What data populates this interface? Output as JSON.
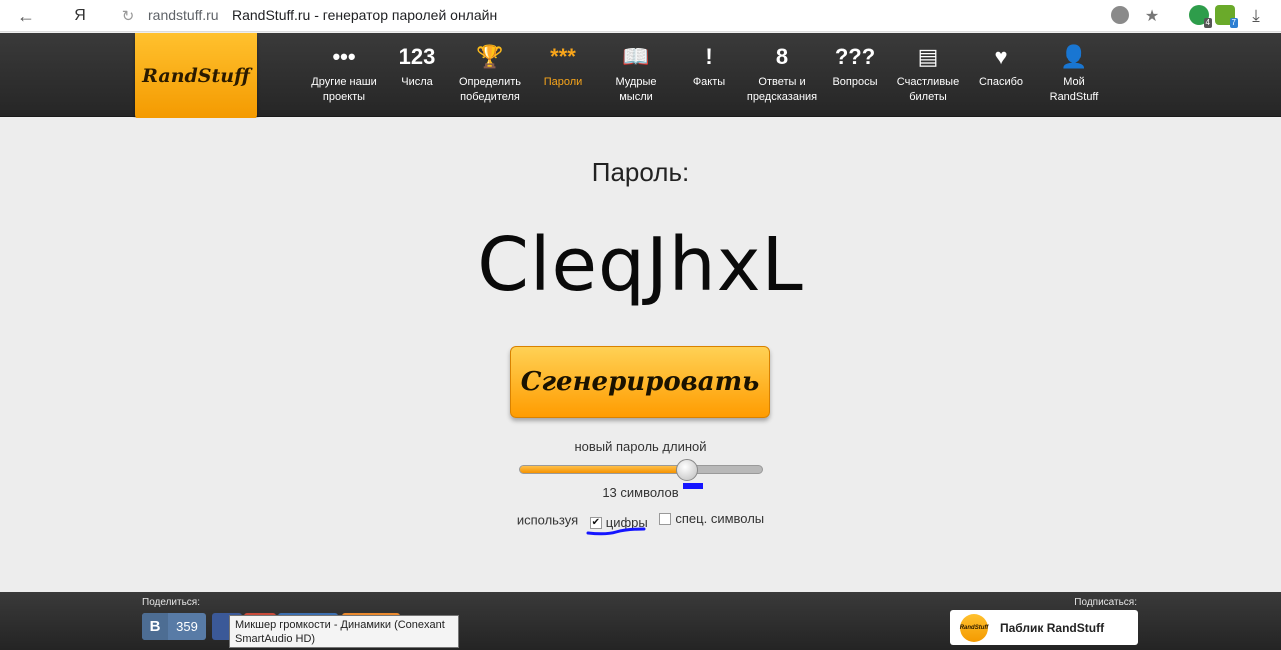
{
  "browser": {
    "back_icon": "back-arrow-icon",
    "yandex_icon": "yandex-logo-icon",
    "reload_icon": "reload-icon",
    "domain": "randstuff.ru",
    "title": "RandStuff.ru - генератор паролей онлайн",
    "extension_badges": [
      "4",
      "7"
    ]
  },
  "site": {
    "logo_text": "RandStuff",
    "nav": [
      {
        "icon": "dots-icon",
        "glyph": "•••",
        "label": "Другие наши\nпроекты"
      },
      {
        "icon": "numbers-icon",
        "glyph": "123",
        "label": "Числа"
      },
      {
        "icon": "trophy-icon",
        "glyph": "🏆",
        "label": "Определить\nпобедителя"
      },
      {
        "icon": "password-stars-icon",
        "glyph": "***",
        "label": "Пароли",
        "active": true
      },
      {
        "icon": "book-icon",
        "glyph": "📖",
        "label": "Мудрые\nмысли"
      },
      {
        "icon": "warning-diamond-icon",
        "glyph": "!",
        "label": "Факты"
      },
      {
        "icon": "magic-ball-icon",
        "glyph": "8",
        "label": "Ответы и\nпредсказания"
      },
      {
        "icon": "questions-icon",
        "glyph": "???",
        "label": "Вопросы"
      },
      {
        "icon": "tickets-icon",
        "glyph": "▤",
        "label": "Счастливые\nбилеты"
      },
      {
        "icon": "heart-icon",
        "glyph": "♥",
        "label": "Спасибо"
      },
      {
        "icon": "user-icon",
        "glyph": "👤",
        "label": "Мой\nRandStuff"
      }
    ]
  },
  "main": {
    "heading": "Пароль:",
    "password": "CleqJhxL",
    "generate_label": "Сгенерировать",
    "length_label": "новый пароль длиной",
    "length_value": "13 символов",
    "slider_fraction": 0.69,
    "using_label": "используя",
    "options": [
      {
        "label": "цифры",
        "checked": true
      },
      {
        "label": "спец. символы",
        "checked": false
      }
    ]
  },
  "footer": {
    "share_label": "Поделиться:",
    "vk_letter": "B",
    "vk_count": "359",
    "subscribe_label": "Подписаться:",
    "subscribe_button": "Паблик RandStuff",
    "subscribe_logo": "RandStuff",
    "tooltip": "Микшер громкости - Динамики (Conexant\nSmartAudio HD)"
  },
  "colors": {
    "accent": "#f7a51b",
    "vk": "#587ba6",
    "annotation": "#1515ff"
  }
}
